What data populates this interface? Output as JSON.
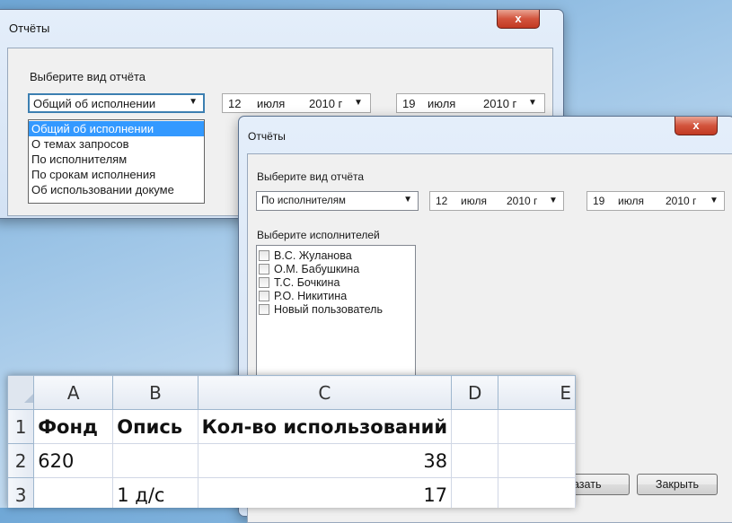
{
  "window1": {
    "title": "Отчёты",
    "close_label": "x",
    "report_type_label": "Выберите вид отчёта",
    "report_type_selected": "Общий об исполнении",
    "report_type_options": [
      "Общий об исполнении",
      "О темах запросов",
      "По исполнителям",
      "По срокам исполнения",
      "Об использовании докуме"
    ],
    "date_from": {
      "day": "12",
      "month": "июля",
      "year": "2010 г"
    },
    "date_to": {
      "day": "19",
      "month": "июля",
      "year": "2010 г"
    }
  },
  "window2": {
    "title": "Отчёты",
    "close_label": "x",
    "report_type_label": "Выберите вид отчёта",
    "report_type_selected": "По исполнителям",
    "date_from": {
      "day": "12",
      "month": "июля",
      "year": "2010 г"
    },
    "date_to": {
      "day": "19",
      "month": "июля",
      "year": "2010 г"
    },
    "executors_label": "Выберите исполнителей",
    "executors": [
      "В.С. Жуланова",
      "О.М. Бабушкина",
      "Т.С. Бочкина",
      "Р.О. Никитина",
      "Новый пользователь"
    ],
    "buttons": {
      "show": "азать",
      "close": "Закрыть"
    }
  },
  "spreadsheet": {
    "columns": [
      "A",
      "B",
      "C",
      "D",
      "E"
    ],
    "rows": [
      {
        "num": "1",
        "cells": [
          "Фонд",
          "Опись",
          "Кол-во использований",
          "",
          ""
        ]
      },
      {
        "num": "2",
        "cells": [
          "620",
          "",
          "38",
          "",
          ""
        ]
      },
      {
        "num": "3",
        "cells": [
          "",
          "1 д/с",
          "17",
          "",
          ""
        ]
      }
    ]
  },
  "icons": {
    "dropdown": "▼",
    "checkbox": "checkbox-icon"
  }
}
